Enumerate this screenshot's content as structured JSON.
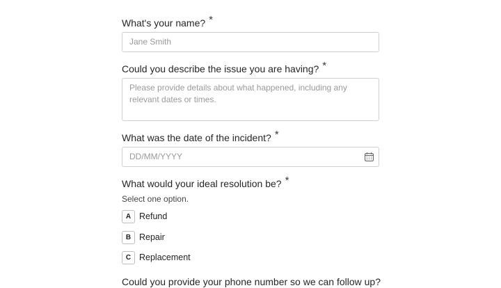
{
  "questions": {
    "name": {
      "label": "What's your name?",
      "required_mark": "*",
      "placeholder": "Jane Smith"
    },
    "issue": {
      "label": "Could you describe the issue you are having?",
      "required_mark": "*",
      "placeholder": "Please provide details about what happened, including any relevant dates or times."
    },
    "date": {
      "label": "What was the date of the incident?",
      "required_mark": "*",
      "placeholder": "DD/MM/YYYY",
      "icon": "calendar-icon"
    },
    "resolution": {
      "label": "What would your ideal resolution be?",
      "required_mark": "*",
      "helper": "Select one option.",
      "options": [
        {
          "key": "A",
          "label": "Refund"
        },
        {
          "key": "B",
          "label": "Repair"
        },
        {
          "key": "C",
          "label": "Replacement"
        }
      ]
    },
    "phone": {
      "label": "Could you provide your phone number so we can follow up?"
    }
  }
}
